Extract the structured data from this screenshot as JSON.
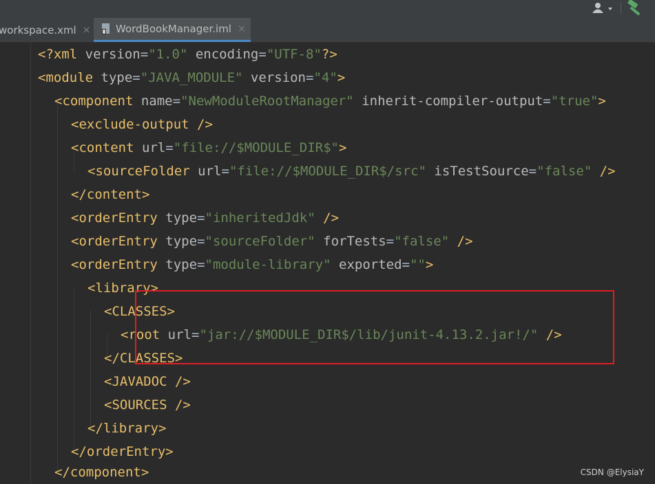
{
  "toolbar": {
    "icons": [
      "user-dropdown-icon",
      "build-hammer-icon"
    ]
  },
  "tabs": [
    {
      "label": "workspace.xml",
      "close": "×",
      "active": false
    },
    {
      "label": "WordBookManager.iml",
      "close": "×",
      "active": true
    }
  ],
  "colors": {
    "tag": "#e8bf6a",
    "attribute": "#bababa",
    "value": "#6a8759",
    "punctuation": "#a9b7c6",
    "highlight": "#e01e23",
    "active_tab_underline": "#4a88c7"
  },
  "code": {
    "l1": {
      "tag": "<?xml",
      "a1": "version",
      "v1": "\"1.0\"",
      "a2": "encoding",
      "v2": "\"UTF-8\"",
      "end": "?>"
    },
    "l2": {
      "tag": "<module",
      "a1": "type",
      "v1": "\"JAVA_MODULE\"",
      "a2": "version",
      "v2": "\"4\"",
      "end": ">"
    },
    "l3": {
      "tag": "<component",
      "a1": "name",
      "v1": "\"NewModuleRootManager\"",
      "a2": "inherit-compiler-output",
      "v2": "\"true\"",
      "end": ">"
    },
    "l4": {
      "tag": "<exclude-output",
      "end": "/>"
    },
    "l5": {
      "tag": "<content",
      "a1": "url",
      "v1": "\"file://$MODULE_DIR$\"",
      "end": ">"
    },
    "l6": {
      "tag": "<sourceFolder",
      "a1": "url",
      "v1": "\"file://$MODULE_DIR$/src\"",
      "a2": "isTestSource",
      "v2": "\"false\"",
      "end": "/>"
    },
    "l7": {
      "tag": "</content>"
    },
    "l8": {
      "tag": "<orderEntry",
      "a1": "type",
      "v1": "\"inheritedJdk\"",
      "end": "/>"
    },
    "l9": {
      "tag": "<orderEntry",
      "a1": "type",
      "v1": "\"sourceFolder\"",
      "a2": "forTests",
      "v2": "\"false\"",
      "end": "/>"
    },
    "l10": {
      "tag": "<orderEntry",
      "a1": "type",
      "v1": "\"module-library\"",
      "a2": "exported",
      "v2": "\"\"",
      "end": ">"
    },
    "l11": {
      "tag": "<library>"
    },
    "l12": {
      "tag": "<CLASSES>"
    },
    "l13": {
      "tag": "<root",
      "a1": "url",
      "v1": "\"jar://$MODULE_DIR$/lib/junit-4.13.2.jar!/\"",
      "end": "/>"
    },
    "l14": {
      "tag": "</CLASSES>"
    },
    "l15": {
      "tag": "<JAVADOC",
      "end": "/>"
    },
    "l16": {
      "tag": "<SOURCES",
      "end": "/>"
    },
    "l17": {
      "tag": "</library>"
    },
    "l18": {
      "tag": "</orderEntry>"
    },
    "l19": {
      "tag": "</component>"
    }
  },
  "watermark": "CSDN @ElysiaY"
}
